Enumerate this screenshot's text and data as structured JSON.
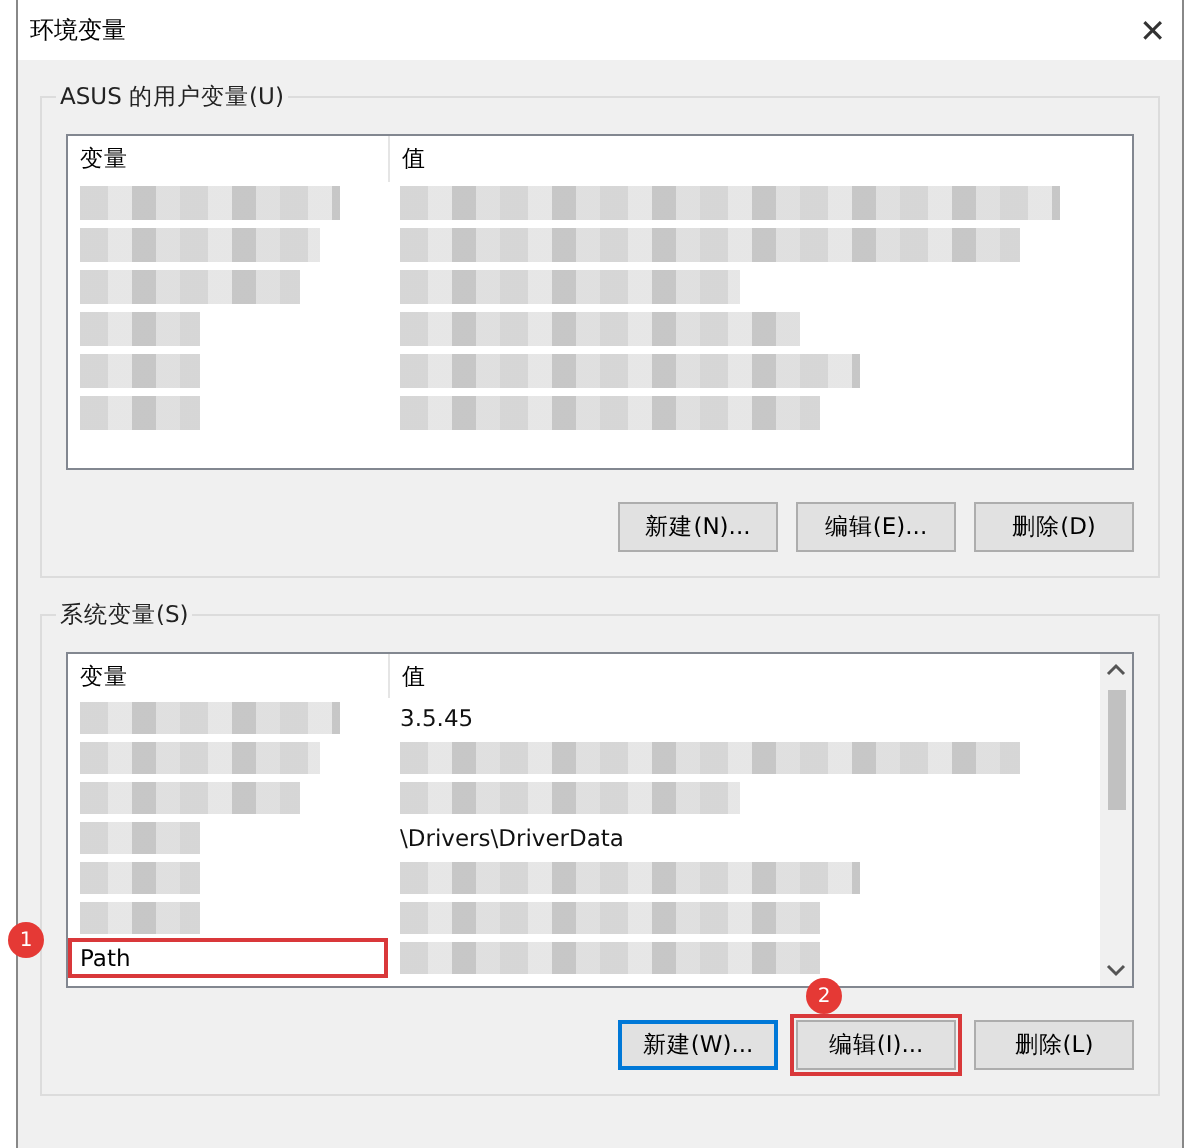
{
  "window": {
    "title": "环境变量",
    "close": "✕"
  },
  "user_variables": {
    "label": "ASUS 的用户变量(U)",
    "columns": [
      "变量",
      "值"
    ],
    "rows": [
      {
        "kind": "blurred"
      },
      {
        "kind": "blurred"
      },
      {
        "kind": "blurred"
      },
      {
        "kind": "blurred"
      },
      {
        "kind": "blurred"
      },
      {
        "kind": "blurred"
      }
    ],
    "buttons": [
      {
        "label": "新建(N)...",
        "focused": false,
        "highlighted": false
      },
      {
        "label": "编辑(E)...",
        "focused": false,
        "highlighted": false
      },
      {
        "label": "删除(D)",
        "focused": false,
        "highlighted": false
      }
    ]
  },
  "system_variables": {
    "label": "系统变量(S)",
    "columns": [
      "变量",
      "值"
    ],
    "rows": [
      {
        "kind": "text",
        "value": "3.5.45"
      },
      {
        "kind": "blurred"
      },
      {
        "kind": "blurred"
      },
      {
        "kind": "text",
        "value": "\\Drivers\\DriverData"
      },
      {
        "kind": "blurred"
      },
      {
        "kind": "blurred"
      },
      {
        "kind": "text",
        "name": "Path",
        "highlighted": true,
        "badge": "1"
      }
    ],
    "buttons": [
      {
        "label": "新建(W)...",
        "focused": true,
        "highlighted": false
      },
      {
        "label": "编辑(I)...",
        "focused": false,
        "highlighted": true,
        "badge": "2"
      },
      {
        "label": "删除(L)",
        "focused": false,
        "highlighted": false
      }
    ]
  }
}
